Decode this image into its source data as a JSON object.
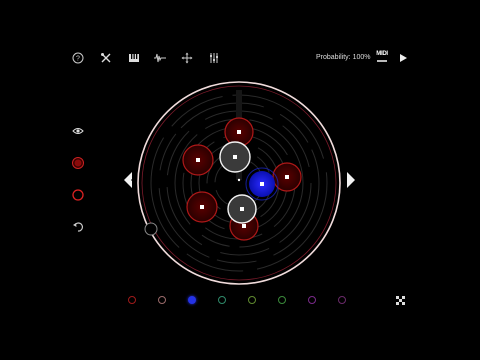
{
  "app": {
    "background": "#000000"
  },
  "toolbar": {
    "items": [
      {
        "icon": "help-icon"
      },
      {
        "icon": "tools-icon"
      },
      {
        "icon": "keyboard-icon"
      },
      {
        "icon": "waveform-icon"
      },
      {
        "icon": "move-icon"
      },
      {
        "icon": "mixer-sliders-icon"
      }
    ],
    "probability_label": "Probability: 100%",
    "midi_label": "MIDI",
    "play_icon": "play-icon"
  },
  "side_tools": [
    {
      "icon": "eye-icon"
    },
    {
      "icon": "add-red-node-icon"
    },
    {
      "icon": "red-ring-icon"
    },
    {
      "icon": "undo-icon"
    }
  ],
  "navigation": {
    "prev_icon": "triangle-left-icon",
    "next_icon": "triangle-right-icon"
  },
  "sequencer": {
    "outer_ring_color": "#f1dcdc",
    "nodes": [
      {
        "id": "top",
        "color": "red"
      },
      {
        "id": "upper-left",
        "color": "red"
      },
      {
        "id": "upper-center",
        "color": "white"
      },
      {
        "id": "right",
        "color": "red"
      },
      {
        "id": "center-blue",
        "color": "blue"
      },
      {
        "id": "lower-left",
        "color": "red"
      },
      {
        "id": "lower-center",
        "color": "white"
      },
      {
        "id": "bottom",
        "color": "red"
      }
    ]
  },
  "palette": {
    "colors": [
      "#a01a1a",
      "#9a6a6a",
      "#2432e6",
      "#2f8a6a",
      "#5f8a2f",
      "#3a8a3a",
      "#7a2a8a",
      "#6a2a6a"
    ],
    "active_index": 2
  },
  "shuffle_icon": "shuffle-icon"
}
